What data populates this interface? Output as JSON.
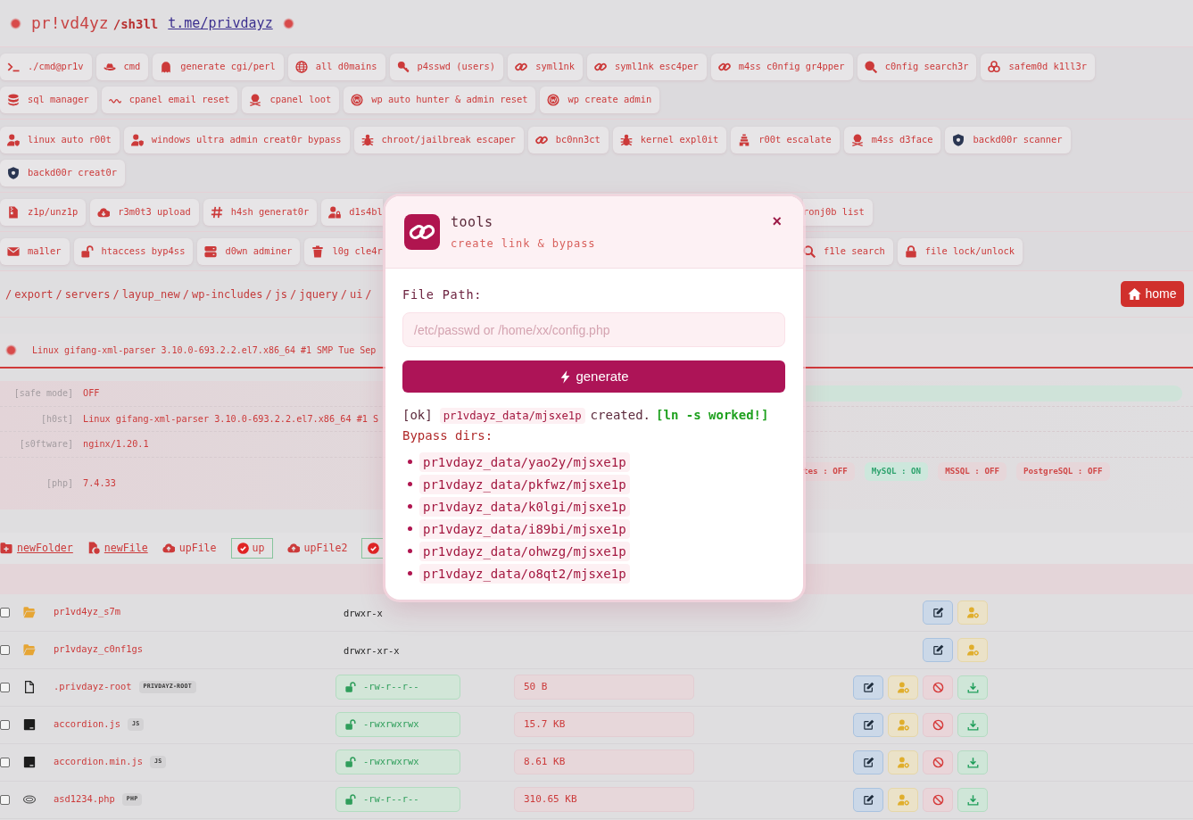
{
  "header": {
    "brand": "pr!vd4yz",
    "suffix": "/sh3ll",
    "link": "t.me/privdayz"
  },
  "tool_groups": [
    {
      "rows": [
        {
          "left": [
            "./cmd@pr1v",
            "cmd",
            "generate cgi/perl",
            "all d0mains",
            "p4sswd (users)",
            "syml1nk",
            "syml1nk esc4per",
            "m4ss c0nfig gr4pper",
            "c0nfig search3r",
            "safem0d k1ll3r"
          ]
        },
        {
          "left": [
            "sql manager",
            "cpanel email reset",
            "cpanel loot",
            "wp auto hunter & admin reset",
            "wp create admin"
          ]
        }
      ]
    },
    {
      "rows": [
        {
          "left": [
            "linux auto r00t",
            "windows ultra admin creat0r bypass",
            "chroot/jailbreak escaper",
            "bc0nn3ct",
            "kernel expl0it",
            "r00t escalate",
            "m4ss d3face",
            "backd00r scanner"
          ]
        },
        {
          "left": [
            "backd00r creat0r"
          ]
        }
      ]
    },
    {
      "rows": [
        {
          "left": [
            "z1p/unz1p",
            "r3m0t3 upload",
            "h4sh generat0r",
            "d1s4bl"
          ],
          "right": [
            "ronj0b list"
          ]
        }
      ]
    },
    {
      "rows": [
        {
          "left": [
            "ma1ler",
            "htaccess byp4ss",
            "d0wn adminer",
            "l0g cle4r"
          ],
          "right": [
            "f1le search",
            "file lock/unlock"
          ]
        }
      ]
    }
  ],
  "breadcrumb": [
    {
      "kind": "separator",
      "text": "/"
    },
    {
      "kind": "segment",
      "text": "export"
    },
    {
      "kind": "separator",
      "text": "/"
    },
    {
      "kind": "segment",
      "text": "servers"
    },
    {
      "kind": "separator",
      "text": "/"
    },
    {
      "kind": "segment",
      "text": "layup_new"
    },
    {
      "kind": "separator",
      "text": "/"
    },
    {
      "kind": "segment",
      "text": "wp-includes"
    },
    {
      "kind": "separator",
      "text": "/"
    },
    {
      "kind": "segment",
      "text": "js"
    },
    {
      "kind": "separator",
      "text": "/"
    },
    {
      "kind": "segment",
      "text": "jquery"
    },
    {
      "kind": "separator",
      "text": "/"
    },
    {
      "kind": "segment",
      "text": "ui"
    },
    {
      "kind": "separator",
      "text": "/"
    }
  ],
  "home_button": "home",
  "uname": "Linux gifang-xml-parser 3.10.0-693.2.2.el7.x86_64 #1 SMP Tue Sep",
  "server_info": [
    {
      "label": "[safe mode]",
      "value": "OFF",
      "banner": {
        "on": true
      }
    },
    {
      "label": "[h0st]",
      "value": "Linux gifang-xml-parser 3.10.0-693.2.2.el7.x86_64 #1 S"
    },
    {
      "label": "[s0ftware]",
      "value": "nginx/1.20.1"
    },
    {
      "label": "[php]",
      "value": "7.4.33",
      "badges": [
        {
          "text": "tes : OFF",
          "on": false
        },
        {
          "text": "MySQL : ON",
          "on": true
        },
        {
          "text": "MSSQL : OFF",
          "on": false
        },
        {
          "text": "PostgreSQL : OFF",
          "on": false
        }
      ]
    }
  ],
  "actions": [
    {
      "kind": "link",
      "label": "newFolder"
    },
    {
      "kind": "link",
      "label": "newFile"
    },
    {
      "kind": "upload",
      "label": "upFile"
    },
    {
      "kind": "submit",
      "label": "up"
    },
    {
      "kind": "upload",
      "label": "upFile2"
    },
    {
      "kind": "submit"
    }
  ],
  "files": [
    {
      "kind": "folder",
      "name": "pr1vd4yz_s7m",
      "perms": "drwxr-x",
      "checked": false
    },
    {
      "kind": "folder",
      "name": "pr1vdayz_c0nf1gs",
      "perms": "drwxr-xr-x",
      "checked": false
    },
    {
      "kind": "file",
      "name": ".privdayz-root",
      "tag": "PRIVDAYZ-ROOT",
      "perms": "-rw-r--r--",
      "size": "50 B",
      "checked": false
    },
    {
      "kind": "script",
      "name": "accordion.js",
      "tag": "JS",
      "perms": "-rwxrwxrwx",
      "size": "15.7 KB",
      "checked": false
    },
    {
      "kind": "script",
      "name": "accordion.min.js",
      "tag": "JS",
      "perms": "-rwxrwxrwx",
      "size": "8.61 KB",
      "checked": false
    },
    {
      "kind": "php",
      "name": "asd1234.php",
      "tag": "PHP",
      "perms": "-rw-r--r--",
      "size": "310.65 KB",
      "checked": false
    }
  ],
  "dialog": {
    "title": "tools",
    "subtitle": "create link & bypass",
    "close": "×",
    "field_label": "File Path:",
    "placeholder": "/etc/passwd or /home/xx/config.php",
    "button": "generate",
    "result": {
      "status": "[ok]",
      "path": "pr1vdayz_data/mjsxe1p",
      "message": "created.",
      "note": "[ln -s worked!]"
    },
    "list_title": "Bypass dirs:",
    "bypass_dirs": [
      "pr1vdayz_data/yao2y/mjsxe1p",
      "pr1vdayz_data/pkfwz/mjsxe1p",
      "pr1vdayz_data/k0lgi/mjsxe1p",
      "pr1vdayz_data/i89bi/mjsxe1p",
      "pr1vdayz_data/ohwzg/mjsxe1p",
      "pr1vdayz_data/o8qt2/mjsxe1p"
    ]
  }
}
